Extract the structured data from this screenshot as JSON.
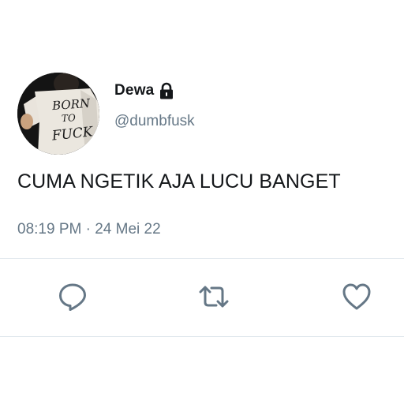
{
  "user": {
    "display_name": "Dewa",
    "handle": "@dumbfusk",
    "protected_icon": "lock-icon",
    "avatar_shirt_text": [
      "BORN",
      "TO",
      "FUCK"
    ]
  },
  "tweet": {
    "text": "CUMA NGETIK AJA LUCU BANGET",
    "time": "08:19 PM",
    "separator": "·",
    "date": "24 Mei 22"
  },
  "actions": {
    "reply_icon": "reply-icon",
    "retweet_icon": "retweet-icon",
    "like_icon": "heart-icon"
  },
  "colors": {
    "text_primary": "#14171a",
    "text_secondary": "#657786",
    "divider": "#e1e8ed"
  }
}
